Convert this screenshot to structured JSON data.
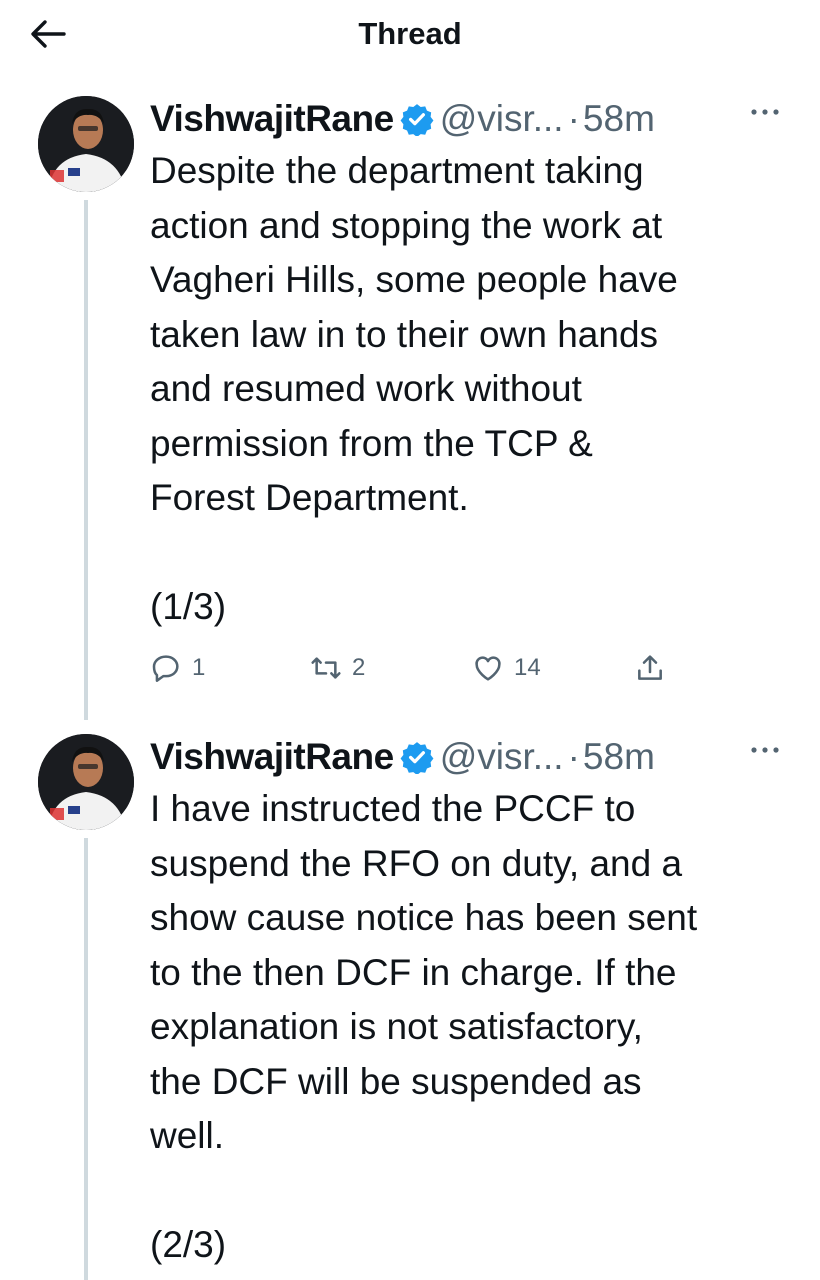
{
  "header": {
    "title": "Thread",
    "back_icon": "arrow-left-icon"
  },
  "tweets": [
    {
      "name": "VishwajitRane",
      "handle": "@visr...",
      "separator": "·",
      "time": "58m",
      "text": "Despite the department taking\naction and stopping the work at\nVagheri Hills, some people have\ntaken law in to their own hands\nand resumed work without\npermission from the TCP &\nForest Department.\n\n(1/3)",
      "replies": "1",
      "retweets": "2",
      "likes": "14"
    },
    {
      "name": "VishwajitRane",
      "handle": "@visr...",
      "separator": "·",
      "time": "58m",
      "text": "I have instructed the PCCF to\nsuspend the RFO on duty, and a\nshow cause notice has been sent\nto the then DCF in charge. If the\nexplanation is not satisfactory,\nthe DCF will be suspended as\nwell.\n\n(2/3)"
    }
  ],
  "colors": {
    "verified": "#1d9bf0",
    "muted": "#536471",
    "thread_line": "#cfd9de"
  }
}
